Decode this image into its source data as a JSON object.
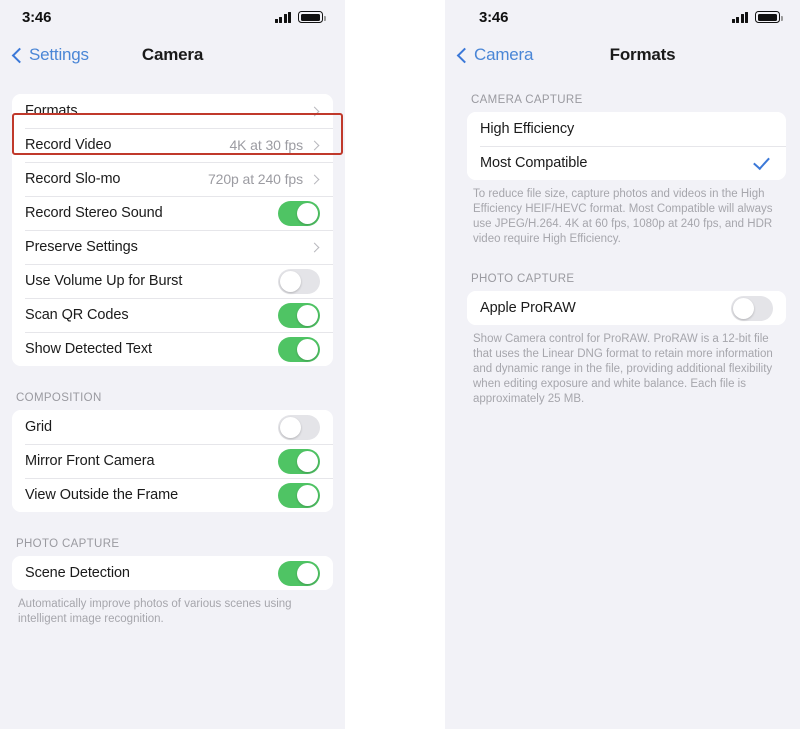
{
  "colors": {
    "accent_blue": "#4a86d6",
    "toggle_on_green": "#4fc464",
    "highlight_red": "#c0392b",
    "check_blue": "#3b78d8"
  },
  "left_screen": {
    "status": {
      "time": "3:46",
      "signal_icon": "signal-bars-icon",
      "battery_icon": "battery-icon"
    },
    "nav": {
      "back_label": "Settings",
      "back_icon": "chevron-left-icon",
      "title": "Camera"
    },
    "groups": [
      {
        "header": "",
        "rows": [
          {
            "label": "Formats",
            "type": "disclosure",
            "value": "",
            "icon": "chevron-right-icon",
            "highlighted": true
          },
          {
            "label": "Record Video",
            "type": "disclosure",
            "value": "4K at 30 fps",
            "icon": "chevron-right-icon"
          },
          {
            "label": "Record Slo-mo",
            "type": "disclosure",
            "value": "720p at 240 fps",
            "icon": "chevron-right-icon"
          },
          {
            "label": "Record Stereo Sound",
            "type": "toggle",
            "on": true
          },
          {
            "label": "Preserve Settings",
            "type": "disclosure",
            "value": "",
            "icon": "chevron-right-icon"
          },
          {
            "label": "Use Volume Up for Burst",
            "type": "toggle",
            "on": false
          },
          {
            "label": "Scan QR Codes",
            "type": "toggle",
            "on": true
          },
          {
            "label": "Show Detected Text",
            "type": "toggle",
            "on": true
          }
        ],
        "footer": ""
      },
      {
        "header": "COMPOSITION",
        "rows": [
          {
            "label": "Grid",
            "type": "toggle",
            "on": false
          },
          {
            "label": "Mirror Front Camera",
            "type": "toggle",
            "on": true
          },
          {
            "label": "View Outside the Frame",
            "type": "toggle",
            "on": true
          }
        ],
        "footer": ""
      },
      {
        "header": "PHOTO CAPTURE",
        "rows": [
          {
            "label": "Scene Detection",
            "type": "toggle",
            "on": true
          }
        ],
        "footer": "Automatically improve photos of various scenes using intelligent image recognition."
      }
    ]
  },
  "right_screen": {
    "status": {
      "time": "3:46",
      "signal_icon": "signal-bars-icon",
      "battery_icon": "battery-icon"
    },
    "nav": {
      "back_label": "Camera",
      "back_icon": "chevron-left-icon",
      "title": "Formats"
    },
    "groups": [
      {
        "header": "CAMERA CAPTURE",
        "rows": [
          {
            "label": "High Efficiency",
            "type": "option",
            "selected": false
          },
          {
            "label": "Most Compatible",
            "type": "option",
            "selected": true,
            "icon": "checkmark-icon",
            "highlighted": true
          }
        ],
        "footer": "To reduce file size, capture photos and videos in the High Efficiency HEIF/HEVC format. Most Compatible will always use JPEG/H.264. 4K at 60 fps, 1080p at 240 fps, and HDR video require High Efficiency."
      },
      {
        "header": "PHOTO CAPTURE",
        "rows": [
          {
            "label": "Apple ProRAW",
            "type": "toggle",
            "on": false
          }
        ],
        "footer": "Show Camera control for ProRAW. ProRAW is a 12-bit file that uses the Linear DNG format to retain more information and dynamic range in the file, providing additional flexibility when editing exposure and white balance. Each file is approximately 25 MB."
      }
    ]
  }
}
